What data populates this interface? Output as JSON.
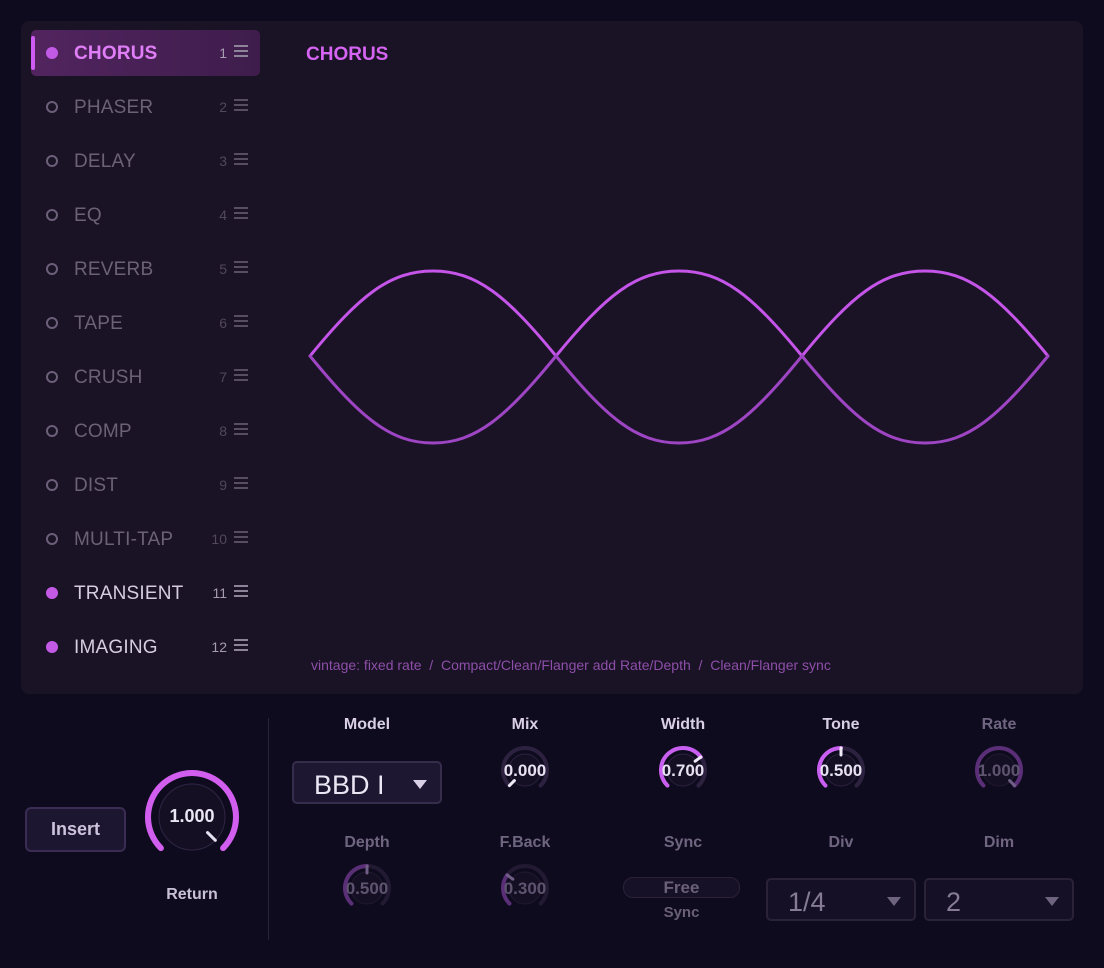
{
  "effects": [
    {
      "name": "CHORUS",
      "num": "1",
      "state": "active"
    },
    {
      "name": "PHASER",
      "num": "2",
      "state": "off"
    },
    {
      "name": "DELAY",
      "num": "3",
      "state": "off"
    },
    {
      "name": "EQ",
      "num": "4",
      "state": "off"
    },
    {
      "name": "REVERB",
      "num": "5",
      "state": "off"
    },
    {
      "name": "TAPE",
      "num": "6",
      "state": "off"
    },
    {
      "name": "CRUSH",
      "num": "7",
      "state": "off"
    },
    {
      "name": "COMP",
      "num": "8",
      "state": "off"
    },
    {
      "name": "DIST",
      "num": "9",
      "state": "off"
    },
    {
      "name": "MULTI-TAP",
      "num": "10",
      "state": "off"
    },
    {
      "name": "TRANSIENT",
      "num": "11",
      "state": "on"
    },
    {
      "name": "IMAGING",
      "num": "12",
      "state": "on"
    }
  ],
  "display": {
    "title": "CHORUS",
    "caption": "vintage: fixed rate  /  Compact/Clean/Flanger add Rate/Depth  /  Clean/Flanger sync"
  },
  "left_controls": {
    "insert_label": "Insert",
    "return_label": "Return",
    "return_value": "1.000",
    "return_level": 1.0
  },
  "params": {
    "model": {
      "label": "Model",
      "value": "BBD I"
    },
    "mix": {
      "label": "Mix",
      "value": "0.000",
      "level": 0.0
    },
    "width": {
      "label": "Width",
      "value": "0.700",
      "level": 0.7
    },
    "tone": {
      "label": "Tone",
      "value": "0.500",
      "level": 0.5
    },
    "rate": {
      "label": "Rate",
      "value": "1.000",
      "level": 1.0
    },
    "depth": {
      "label": "Depth",
      "value": "0.500",
      "level": 0.5
    },
    "feedback": {
      "label": "F.Back",
      "value": "0.300",
      "level": 0.3
    },
    "sync": {
      "label": "Sync",
      "value": "Free",
      "sub": "Sync"
    },
    "div": {
      "label": "Div",
      "value": "1/4"
    },
    "dim": {
      "label": "Dim",
      "value": "2"
    }
  },
  "colors": {
    "accent": "#d564f2",
    "background": "#0f0b1e",
    "panel": "#1a1225"
  }
}
